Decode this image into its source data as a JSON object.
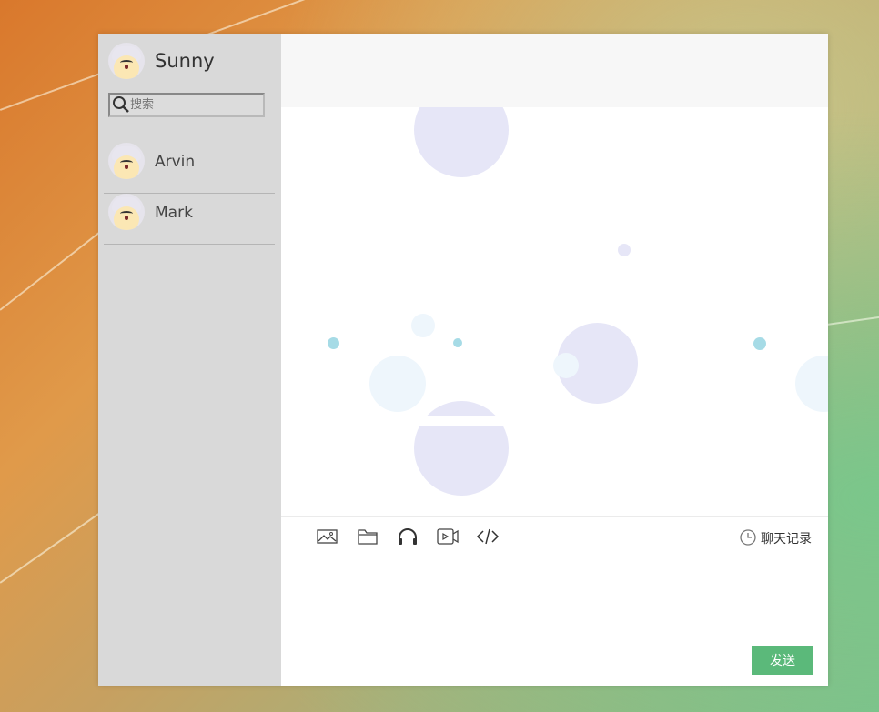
{
  "user": {
    "name": "Sunny",
    "avatar_icon": "cartoon-avatar-icon"
  },
  "search": {
    "placeholder": "搜索",
    "value": "",
    "icon": "search-icon"
  },
  "contacts": [
    {
      "name": "Arvin",
      "avatar_icon": "cartoon-avatar-icon"
    },
    {
      "name": "Mark",
      "avatar_icon": "cartoon-avatar-icon"
    }
  ],
  "toolbar": {
    "tools": [
      "image-icon",
      "folder-icon",
      "headphones-icon",
      "video-icon",
      "code-icon"
    ],
    "history_label": "聊天记录",
    "history_icon": "clock-icon"
  },
  "compose": {
    "value": ""
  },
  "send_label": "发送",
  "colors": {
    "sidebar": "#d9d9d9",
    "send_button": "#5bb97a",
    "header": "#f7f7f7"
  }
}
